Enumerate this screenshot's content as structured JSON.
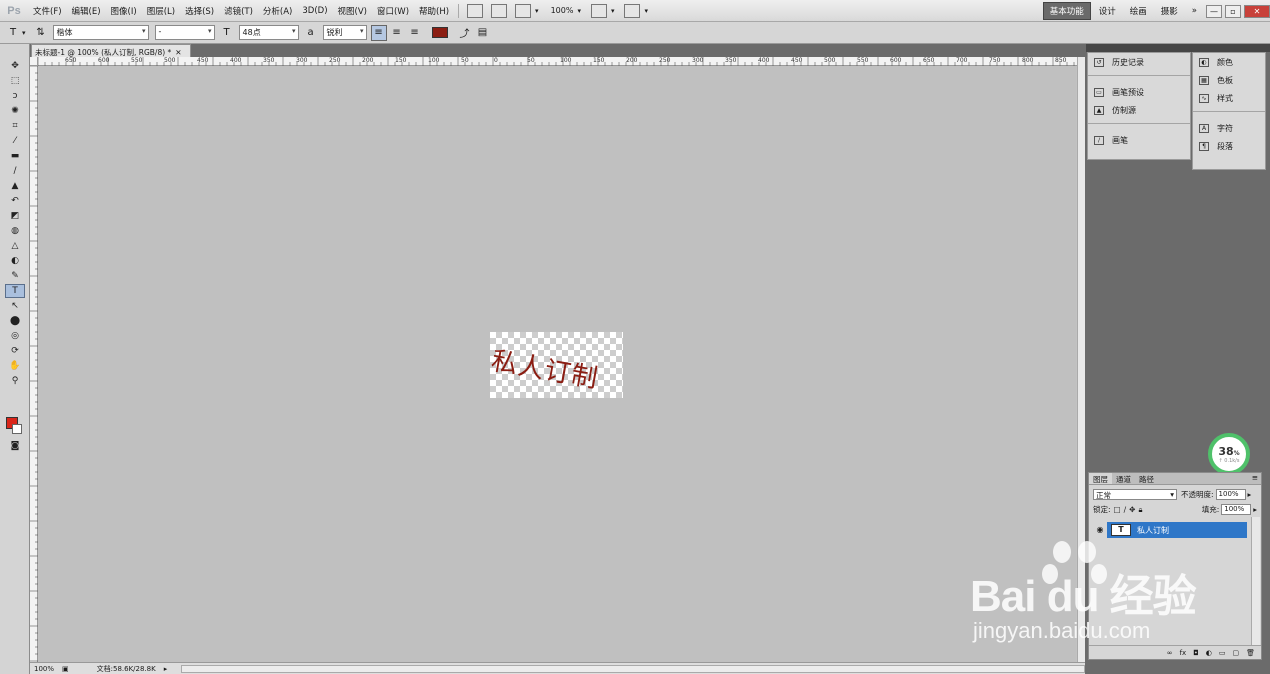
{
  "app": {
    "logo": "Ps"
  },
  "menu": [
    "文件(F)",
    "编辑(E)",
    "图像(I)",
    "图层(L)",
    "选择(S)",
    "滤镜(T)",
    "分析(A)",
    "3D(D)",
    "视图(V)",
    "窗口(W)",
    "帮助(H)"
  ],
  "menubar": {
    "zoom": "100%"
  },
  "workspaces": [
    "基本功能",
    "设计",
    "绘画",
    "摄影"
  ],
  "workspace_more": "»",
  "window_controls": {
    "minimize": "—",
    "restore": "▫",
    "close": "✕"
  },
  "options": {
    "tool_glyph": "T",
    "font_family": "楷体",
    "font_style": "-",
    "font_size": "48点",
    "antialias": "锐利",
    "text_color": "#8b1d12"
  },
  "document": {
    "tab_title": "未标题-1 @ 100% (私人订制, RGB/8) *",
    "tab_close": "✕",
    "canvas_text": "私人订制",
    "text_color": "#8b1d12"
  },
  "ruler": {
    "ticks": [
      "650",
      "600",
      "550",
      "500",
      "450",
      "400",
      "350",
      "300",
      "250",
      "200",
      "150",
      "100",
      "50",
      "0",
      "50",
      "100",
      "150",
      "200",
      "250",
      "300",
      "350",
      "400",
      "450",
      "500",
      "550",
      "600",
      "650",
      "700",
      "750",
      "800",
      "850"
    ]
  },
  "status": {
    "zoom": "100%",
    "doc_size": "文档:58.6K/28.8K"
  },
  "panels": {
    "col1": [
      "历史记录",
      "画笔预设",
      "仿制源",
      "画笔"
    ],
    "col2": [
      "颜色",
      "色板",
      "样式",
      "字符",
      "段落"
    ]
  },
  "layers": {
    "tabs": [
      "图层",
      "通道",
      "路径"
    ],
    "blend_mode": "正常",
    "opacity_label": "不透明度:",
    "opacity_value": "100%",
    "lock_label": "锁定:",
    "fill_label": "填充:",
    "fill_value": "100%",
    "layer_name": "私人订制",
    "layer_type_glyph": "T"
  },
  "progress": {
    "value": "38",
    "unit": "%",
    "sub": "↑ 0.1k/s"
  },
  "watermark": {
    "logo": "Bai du 经验",
    "url": "jingyan.baidu.com"
  }
}
